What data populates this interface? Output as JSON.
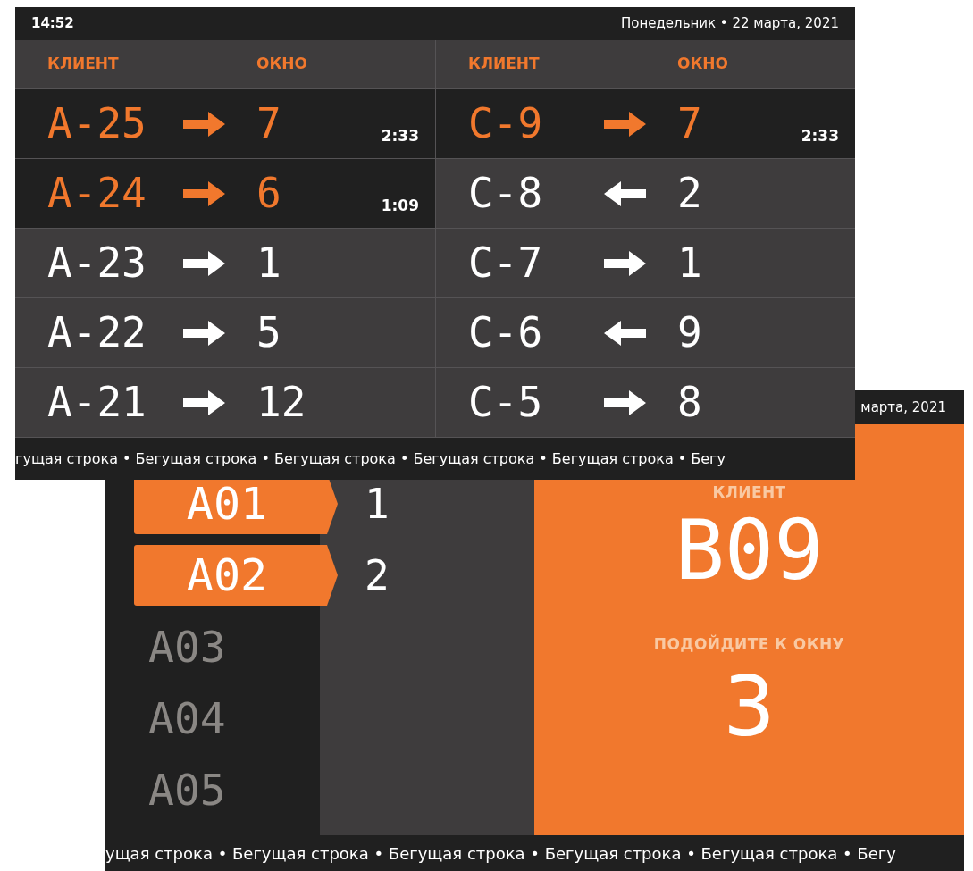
{
  "back_screen": {
    "header": {
      "date_fragment": "марта, 2021"
    },
    "queue": [
      {
        "ticket": "A01",
        "window": "1",
        "called": true
      },
      {
        "ticket": "A02",
        "window": "2",
        "called": true
      },
      {
        "ticket": "A03",
        "called": false
      },
      {
        "ticket": "A04",
        "called": false
      },
      {
        "ticket": "A05",
        "called": false
      }
    ],
    "call_panel": {
      "client_label": "КЛИЕНТ",
      "client": "B09",
      "prompt": "ПОДОЙДИТЕ К ОКНУ",
      "window": "3"
    },
    "ticker": "ущая строка • Бегущая строка • Бегущая строка • Бегущая строка • Бегущая строка • Бегу"
  },
  "front_screen": {
    "header": {
      "clock": "14:52",
      "date_line": "Понедельник • 22 марта, 2021"
    },
    "columns": [
      {
        "headers": [
          "КЛИЕНТ",
          "ОКНО"
        ],
        "rows": [
          {
            "ticket": "A-25",
            "kind": "right",
            "window": "7",
            "called": true,
            "timer": "2:33"
          },
          {
            "ticket": "A-24",
            "kind": "right",
            "window": "6",
            "called": true,
            "timer": "1:09"
          },
          {
            "ticket": "A-23",
            "kind": "right",
            "window": "1",
            "called": false
          },
          {
            "ticket": "A-22",
            "kind": "right",
            "window": "5",
            "called": false
          },
          {
            "ticket": "A-21",
            "kind": "right",
            "window": "12",
            "called": false
          }
        ]
      },
      {
        "headers": [
          "КЛИЕНТ",
          "ОКНО"
        ],
        "rows": [
          {
            "ticket": "C-9",
            "kind": "right",
            "window": "7",
            "called": true,
            "timer": "2:33"
          },
          {
            "ticket": "C-8",
            "kind": "left",
            "window": "2",
            "called": false
          },
          {
            "ticket": "C-7",
            "kind": "right",
            "window": "1",
            "called": false
          },
          {
            "ticket": "C-6",
            "kind": "left",
            "window": "9",
            "called": false
          },
          {
            "ticket": "C-5",
            "kind": "right",
            "window": "8",
            "called": false
          }
        ]
      }
    ],
    "ticker": "гущая строка • Бегущая строка • Бегущая строка • Бегущая строка • Бегущая строка • Бегу"
  }
}
